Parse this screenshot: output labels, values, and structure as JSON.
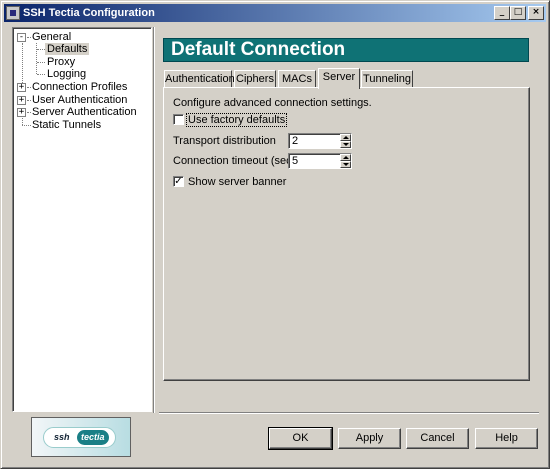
{
  "window": {
    "title": "SSH Tectia Configuration",
    "controls": {
      "minimize": "_",
      "maximize": "□",
      "close": "×"
    }
  },
  "tree": {
    "items": [
      {
        "label": "General",
        "expander": "-"
      },
      {
        "label": "Defaults"
      },
      {
        "label": "Proxy"
      },
      {
        "label": "Logging"
      },
      {
        "label": "Connection Profiles",
        "expander": "+"
      },
      {
        "label": "User Authentication",
        "expander": "+"
      },
      {
        "label": "Server Authentication",
        "expander": "+"
      },
      {
        "label": "Static Tunnels"
      }
    ],
    "selected": "Defaults"
  },
  "header": {
    "title": "Default Connection",
    "color": "#0f7275"
  },
  "tabs": [
    "Authentication",
    "Ciphers",
    "MACs",
    "Server",
    "Tunneling"
  ],
  "active_tab": "Server",
  "server": {
    "description": "Configure advanced connection settings.",
    "use_factory_defaults": {
      "label": "Use factory defaults",
      "checked": false,
      "mark": ""
    },
    "transport_distribution": {
      "label": "Transport distribution",
      "value": "2"
    },
    "connection_timeout": {
      "label": "Connection timeout (seconds)",
      "value": "5"
    },
    "show_server_banner": {
      "label": "Show server banner",
      "checked": true,
      "mark": "✓"
    }
  },
  "logo": {
    "ssh": "ssh",
    "tectia": "tectia"
  },
  "buttons": {
    "ok": "OK",
    "apply": "Apply",
    "cancel": "Cancel",
    "help": "Help"
  }
}
